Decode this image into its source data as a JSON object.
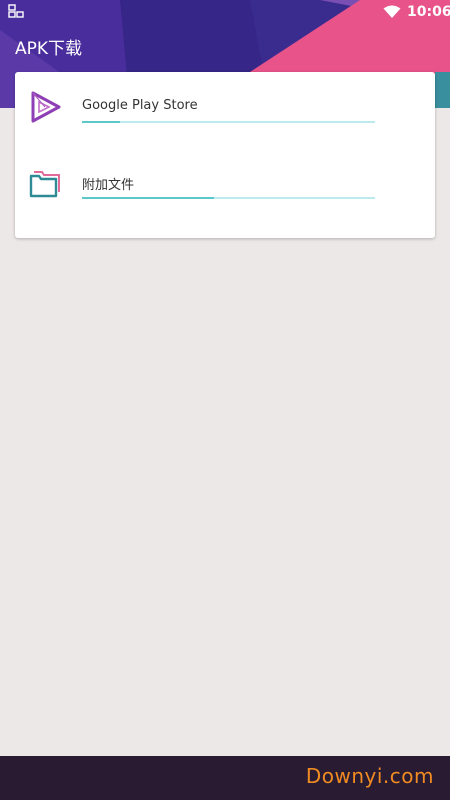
{
  "status_bar": {
    "time": "10:06",
    "left_icon": "screenshot-icon",
    "wifi_icon": "wifi-icon"
  },
  "app": {
    "title": "APK下载"
  },
  "downloads": [
    {
      "label": "Google Play Store",
      "icon": "play-store-icon",
      "progress": 0.13
    },
    {
      "label": "附加文件",
      "icon": "folder-icon",
      "progress": 0.45
    }
  ],
  "footer": {
    "watermark": "Downyi.com"
  },
  "colors": {
    "header_purple": "#3a2b8f",
    "header_pink": "#e8548a",
    "header_teal": "#3a8f9e",
    "progress_track": "#bdebed",
    "progress_fill": "#5bc8ca",
    "background": "#ede8e8",
    "footer": "#281b32",
    "watermark": "#f08a22"
  }
}
